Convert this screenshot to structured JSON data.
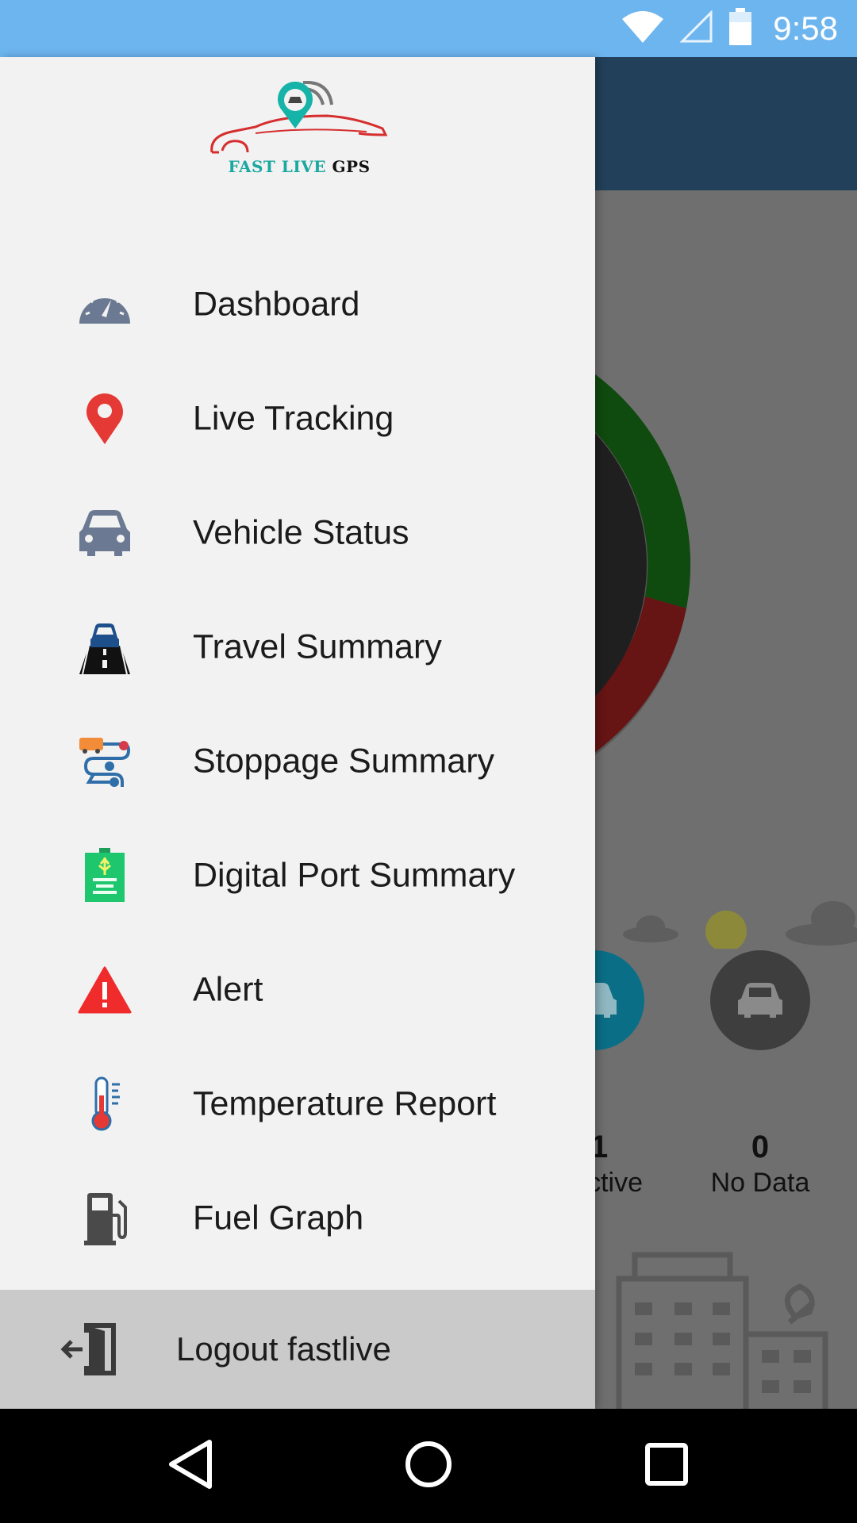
{
  "status_bar": {
    "time": "9:58"
  },
  "background_app": {
    "stats": [
      {
        "count": "1",
        "label": "ctive"
      },
      {
        "count": "0",
        "label": "No Data"
      }
    ]
  },
  "drawer": {
    "logo": {
      "text_part1": "FAST LIVE",
      "text_part2": "GPS"
    },
    "menu": [
      {
        "label": "Dashboard",
        "icon": "speedometer-icon"
      },
      {
        "label": "Live Tracking",
        "icon": "location-pin-icon"
      },
      {
        "label": "Vehicle Status",
        "icon": "car-icon"
      },
      {
        "label": "Travel Summary",
        "icon": "car-road-icon"
      },
      {
        "label": "Stoppage Summary",
        "icon": "route-stops-icon"
      },
      {
        "label": "Digital Port Summary",
        "icon": "usb-port-icon"
      },
      {
        "label": "Alert",
        "icon": "warning-icon"
      },
      {
        "label": "Temperature Report",
        "icon": "thermometer-icon"
      },
      {
        "label": "Fuel Graph",
        "icon": "fuel-pump-icon"
      }
    ],
    "logout": {
      "label": "Logout fastlive",
      "icon": "logout-door-icon"
    }
  },
  "colors": {
    "status_bar": "#6db5ef",
    "drawer_bg": "#f2f2f2",
    "logout_bg": "#cacaca",
    "toolbar": "#22405a",
    "chart_green": "#0f4a0f",
    "chart_red": "#661414",
    "pin_red": "#e53935",
    "alert_red": "#f02b2b",
    "icon_slate": "#6b7a92"
  }
}
